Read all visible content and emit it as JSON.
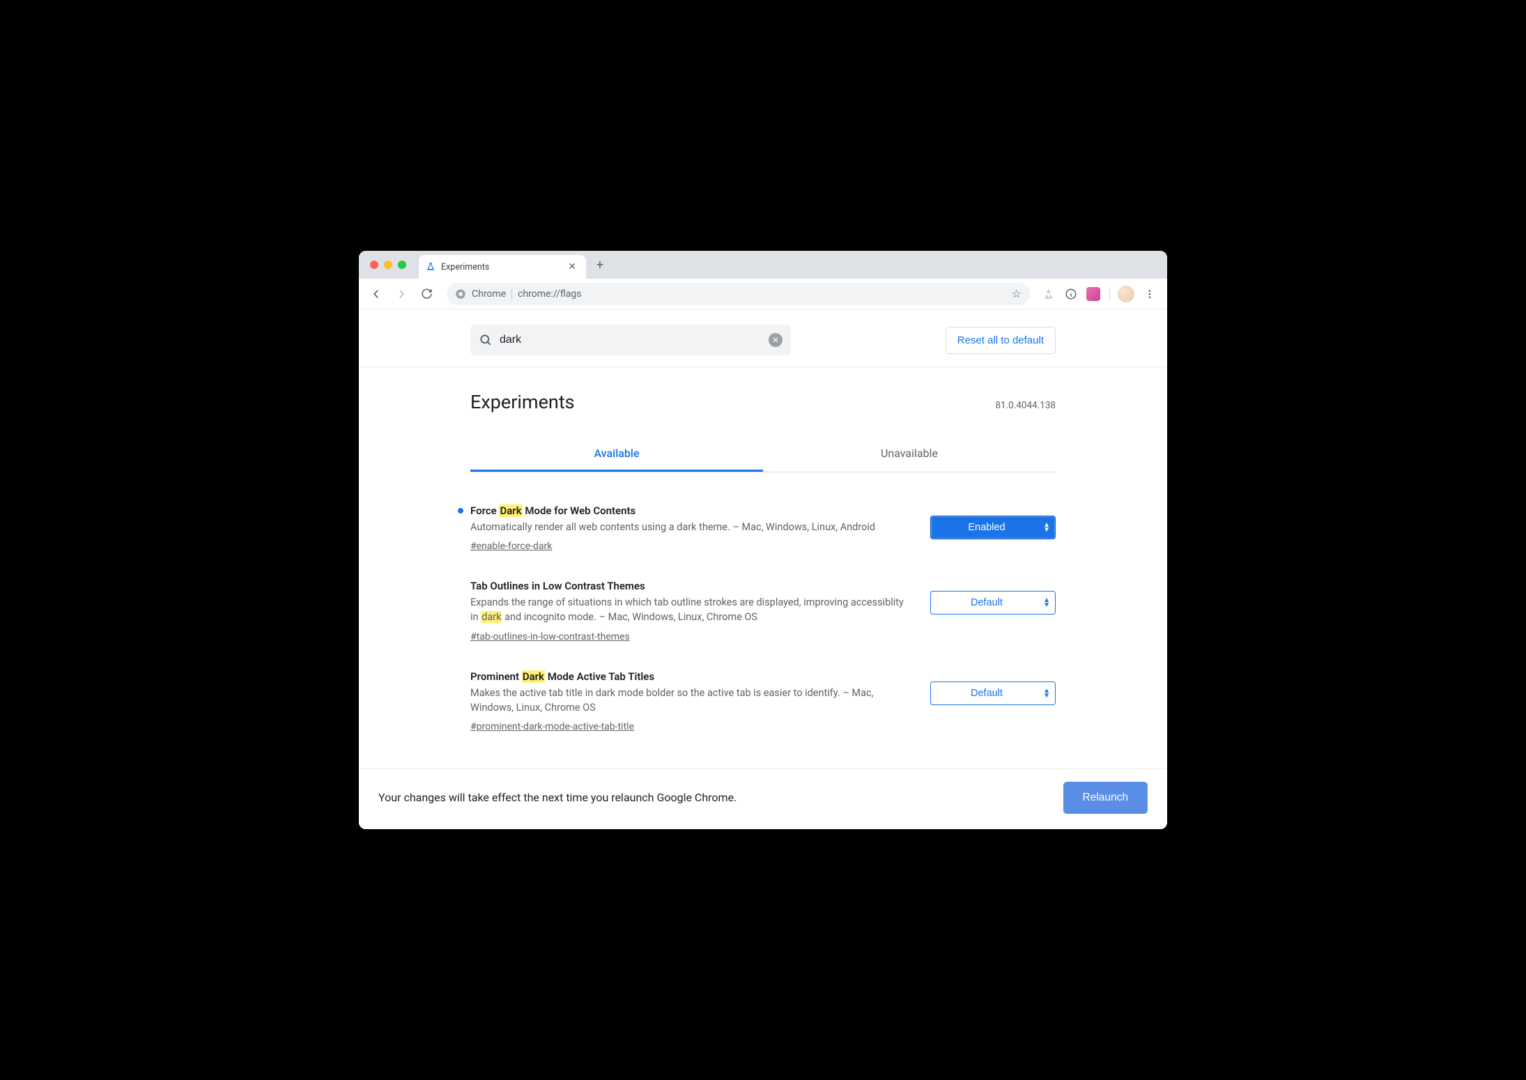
{
  "chrome": {
    "tab_title": "Experiments",
    "omnibox_site": "Chrome",
    "omnibox_url": "chrome://flags"
  },
  "search": {
    "value": "dark"
  },
  "reset_label": "Reset all to default",
  "page_title": "Experiments",
  "version": "81.0.4044.138",
  "tabs": {
    "available": "Available",
    "unavailable": "Unavailable"
  },
  "flags": [
    {
      "modified": true,
      "title_pre": "Force ",
      "title_hl": "Dark",
      "title_post": " Mode for Web Contents",
      "desc_pre": "Automatically render all web contents using a dark theme. – Mac, Windows, Linux, Android",
      "desc_hl": "",
      "desc_post": "",
      "anchor": "#enable-force-dark",
      "select_value": "Enabled",
      "select_style": "enabled"
    },
    {
      "modified": false,
      "title_pre": "Tab Outlines in Low Contrast Themes",
      "title_hl": "",
      "title_post": "",
      "desc_pre": "Expands the range of situations in which tab outline strokes are displayed, improving accessiblity in ",
      "desc_hl": "dark",
      "desc_post": " and incognito mode. – Mac, Windows, Linux, Chrome OS",
      "anchor": "#tab-outlines-in-low-contrast-themes",
      "select_value": "Default",
      "select_style": "default"
    },
    {
      "modified": false,
      "title_pre": "Prominent ",
      "title_hl": "Dark",
      "title_post": " Mode Active Tab Titles",
      "desc_pre": "Makes the active tab title in dark mode bolder so the active tab is easier to identify. – Mac, Windows, Linux, Chrome OS",
      "desc_hl": "",
      "desc_post": "",
      "anchor": "#prominent-dark-mode-active-tab-title",
      "select_value": "Default",
      "select_style": "default"
    }
  ],
  "relaunch": {
    "message": "Your changes will take effect the next time you relaunch Google Chrome.",
    "button": "Relaunch"
  }
}
